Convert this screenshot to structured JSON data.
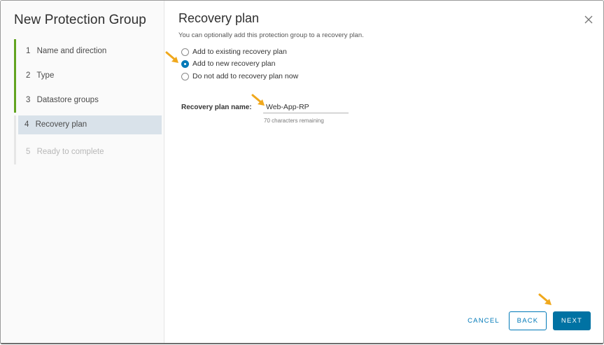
{
  "dialog": {
    "title": "New Protection Group",
    "close_icon": "close-icon"
  },
  "steps": [
    {
      "num": "1",
      "label": "Name and direction",
      "state": "completed"
    },
    {
      "num": "2",
      "label": "Type",
      "state": "completed"
    },
    {
      "num": "3",
      "label": "Datastore groups",
      "state": "completed"
    },
    {
      "num": "4",
      "label": "Recovery plan",
      "state": "active"
    },
    {
      "num": "5",
      "label": "Ready to complete",
      "state": "disabled"
    }
  ],
  "page": {
    "title": "Recovery plan",
    "subtitle": "You can optionally add this protection group to a recovery plan."
  },
  "options": [
    {
      "label": "Add to existing recovery plan",
      "checked": false
    },
    {
      "label": "Add to new recovery plan",
      "checked": true
    },
    {
      "label": "Do not add to recovery plan now",
      "checked": false
    }
  ],
  "plan_name": {
    "label": "Recovery plan name:",
    "value": "Web-App-RP",
    "helper": "70 characters remaining"
  },
  "buttons": {
    "cancel": "CANCEL",
    "back": "BACK",
    "next": "NEXT"
  },
  "colors": {
    "accent": "#0079b8",
    "primary_button": "#0072a3",
    "step_complete": "#62a420",
    "active_step_bg": "#d9e2ea",
    "annotation_arrow": "#f0a81c"
  }
}
